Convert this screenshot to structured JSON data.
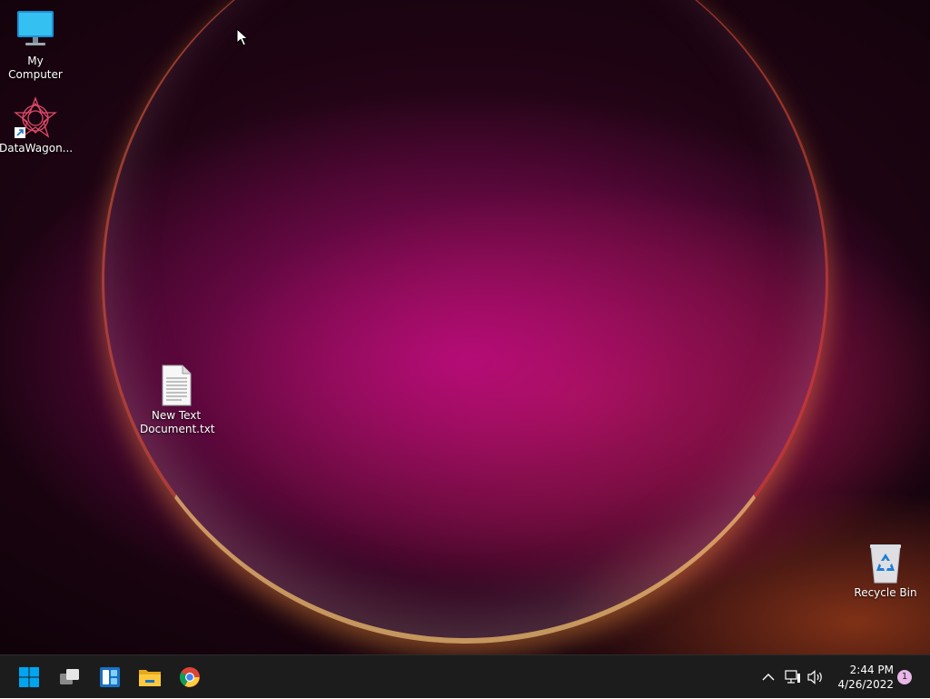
{
  "desktop": {
    "icons": [
      {
        "label": "My Computer",
        "icon": "monitor-icon"
      },
      {
        "label": "DataWagon...",
        "icon": "datawagon-app-icon"
      },
      {
        "label": "New Text\nDocument.txt",
        "icon": "text-document-icon"
      },
      {
        "label": "Recycle Bin",
        "icon": "recycle-bin-icon"
      }
    ]
  },
  "taskbar": {
    "pinned": [
      {
        "name": "start-button",
        "icon": "windows-logo-icon"
      },
      {
        "name": "task-view-button",
        "icon": "task-view-icon"
      },
      {
        "name": "widgets-button",
        "icon": "widgets-icon"
      },
      {
        "name": "file-explorer-button",
        "icon": "folder-icon"
      },
      {
        "name": "chrome-button",
        "icon": "chrome-icon"
      }
    ],
    "tray": {
      "icons": [
        "chevron-up-icon",
        "network-icon",
        "volume-icon"
      ],
      "time": "2:44 PM",
      "date": "4/26/2022",
      "notification_count": "1"
    }
  },
  "colors": {
    "taskbar_bg": "#1c1c1c",
    "start_blue": "#00a4ef",
    "notification_badge": "#e8b7e6"
  }
}
